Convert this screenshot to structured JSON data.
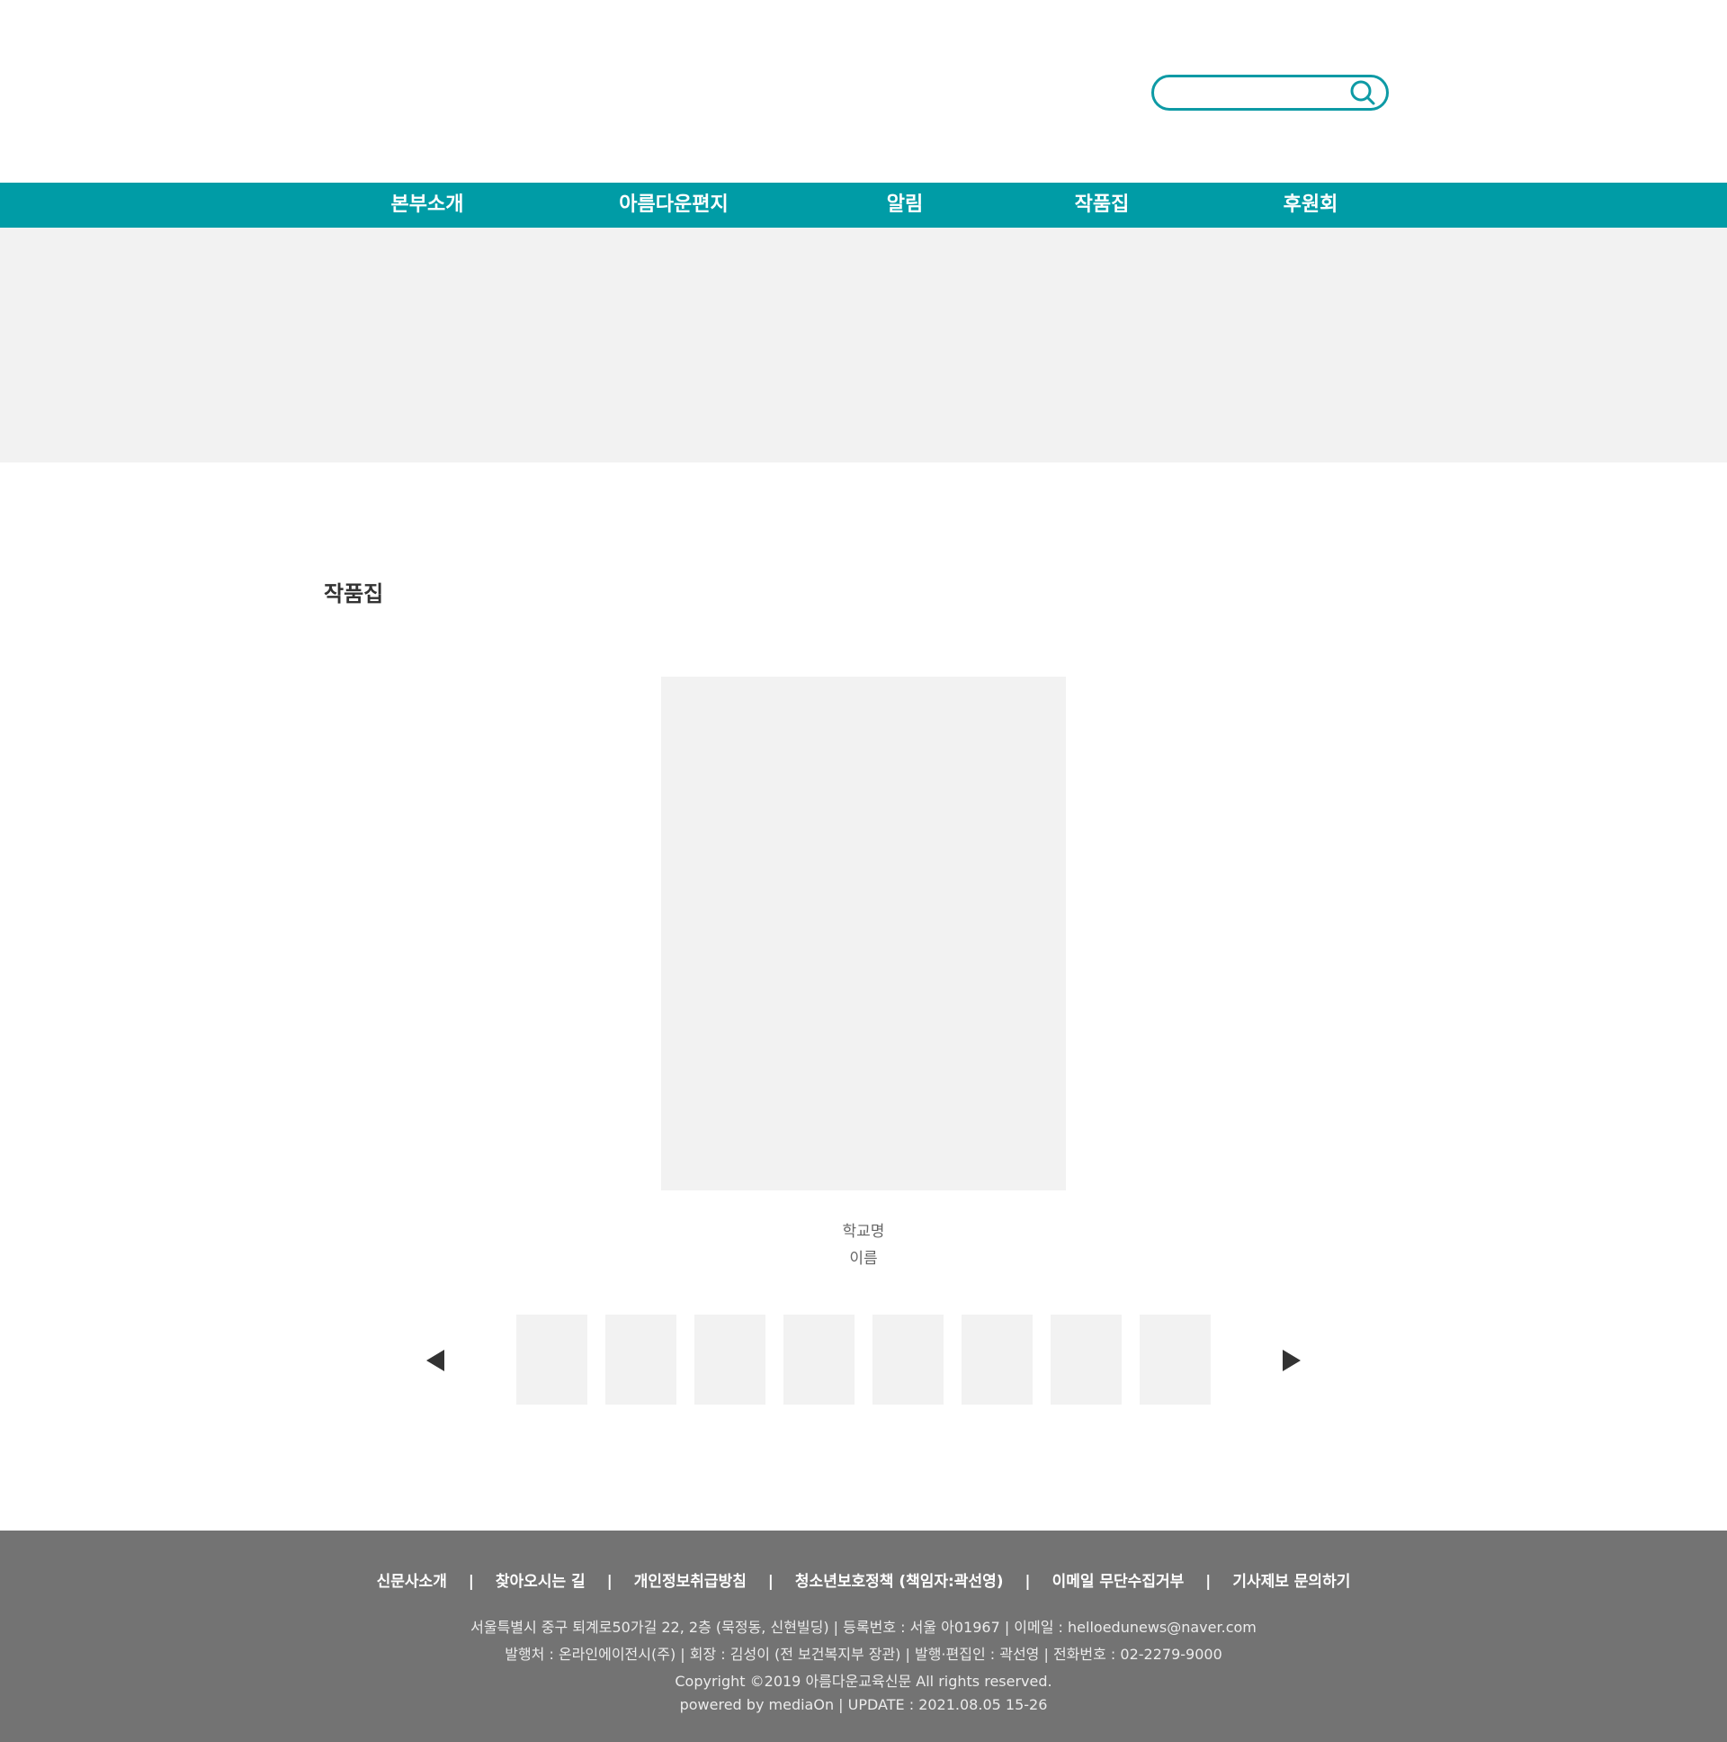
{
  "header": {
    "search": {
      "value": "",
      "placeholder": ""
    },
    "search_icon": "search-icon"
  },
  "nav": {
    "items": [
      "본부소개",
      "아름다운편지",
      "알림",
      "작품집",
      "후원회"
    ]
  },
  "section": {
    "title": "작품집",
    "featured": {
      "school": "학교명",
      "name": "이름"
    },
    "thumbnail_count": 8,
    "prev_icon": "triangle-left-icon",
    "next_icon": "triangle-right-icon"
  },
  "footer": {
    "links": [
      "신문사소개",
      "찾아오시는 길",
      "개인정보취급방침",
      "청소년보호정책 (책임자:곽선영)",
      "이메일 무단수집거부",
      "기사제보 문의하기"
    ],
    "separator": "|",
    "lines": [
      "서울특별시 중구 퇴계로50가길 22, 2층 (묵정동, 신현빌딩) | 등록번호 : 서울 아01967 | 이메일 : helloedunews@naver.com",
      "발행처 : 온라인에이전시(주) | 회장 : 김성이 (전 보건복지부 장관) | 발행·편집인 : 곽선영 | 전화번호 : 02-2279-9000",
      "Copyright ©2019 아름다운교육신문 All rights reserved.",
      "powered by mediaOn | UPDATE : 2021.08.05 15-26"
    ]
  },
  "colors": {
    "accent": "#009ca6",
    "placeholder_gray": "#f2f2f2",
    "footer_bg": "#737373"
  }
}
